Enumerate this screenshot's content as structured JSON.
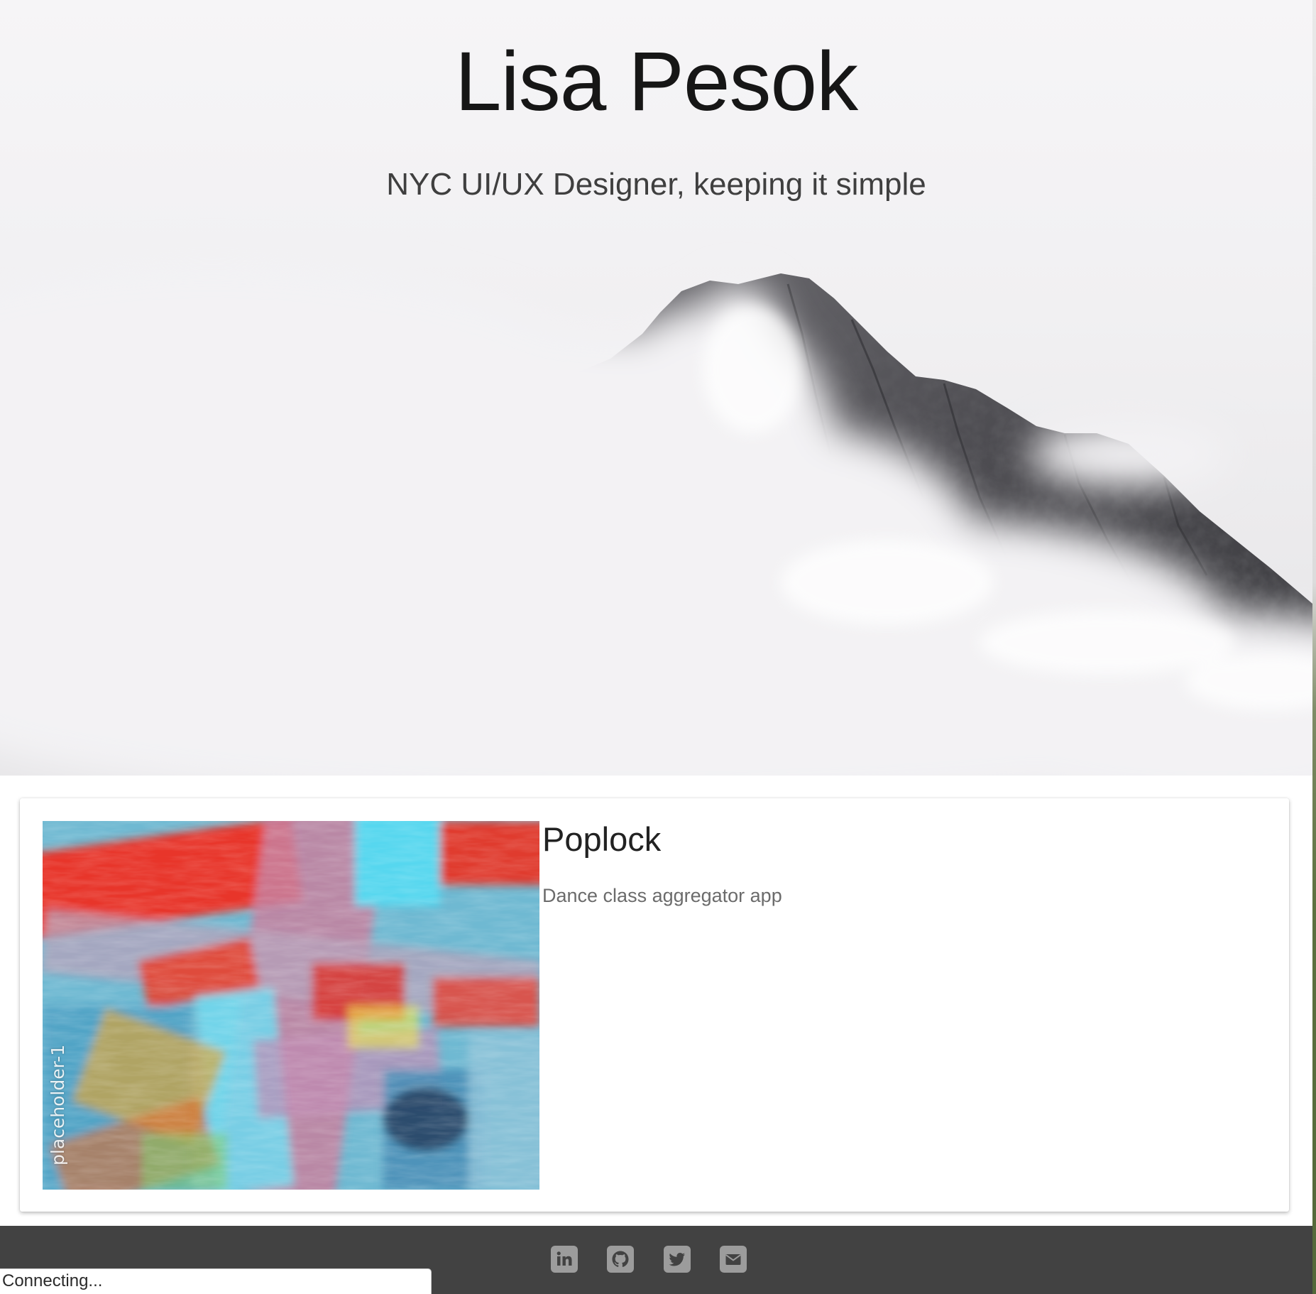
{
  "hero": {
    "title": "Lisa Pesok",
    "subtitle": "NYC UI/UX Designer, keeping it simple",
    "background_image": "misty-mountain-peak-in-clouds"
  },
  "projects": [
    {
      "title": "Poplock",
      "description": "Dance class aggregator app",
      "thumbnail": "abstract-colorful-paint-strokes",
      "thumbnail_caption": "placeholder-1"
    }
  ],
  "footer": {
    "background_color": "#424242",
    "social_links": [
      {
        "icon": "linkedin-icon"
      },
      {
        "icon": "github-icon"
      },
      {
        "icon": "twitter-icon"
      },
      {
        "icon": "email-icon"
      }
    ]
  },
  "browser_status": {
    "text": "Connecting..."
  }
}
